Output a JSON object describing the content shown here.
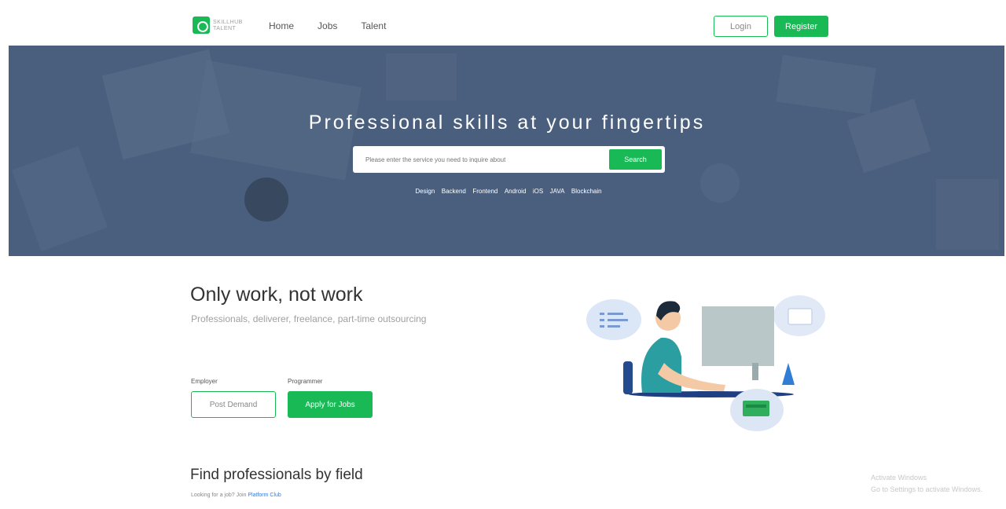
{
  "header": {
    "logo_text": "SKILLHUB\nTALENT",
    "nav": [
      "Home",
      "Jobs",
      "Talent"
    ],
    "login_label": "Login",
    "register_label": "Register"
  },
  "hero": {
    "title": "Professional skills at your fingertips",
    "search_placeholder": "Please enter the service you need to inquire about",
    "search_label": "Search",
    "tags": [
      "Design",
      "Backend",
      "Frontend",
      "Android",
      "iOS",
      "JAVA",
      "Blockchain"
    ]
  },
  "intro": {
    "title": "Only work, not work",
    "subtitle": "Professionals, deliverer, freelance, part-time outsourcing",
    "employer_label": "Employer",
    "programmer_label": "Programmer",
    "post_label": "Post Demand",
    "apply_label": "Apply for Jobs"
  },
  "fields": {
    "title": "Find professionals by field",
    "subtitle_prefix": "Looking for a job? Join",
    "subtitle_link": "Platform Club"
  },
  "watermark": {
    "line1": "Activate Windows",
    "line2": "Go to Settings to activate Windows."
  },
  "colors": {
    "accent": "#19b955",
    "hero_bg": "#4a5f7d",
    "link": "#3a7bd5"
  }
}
